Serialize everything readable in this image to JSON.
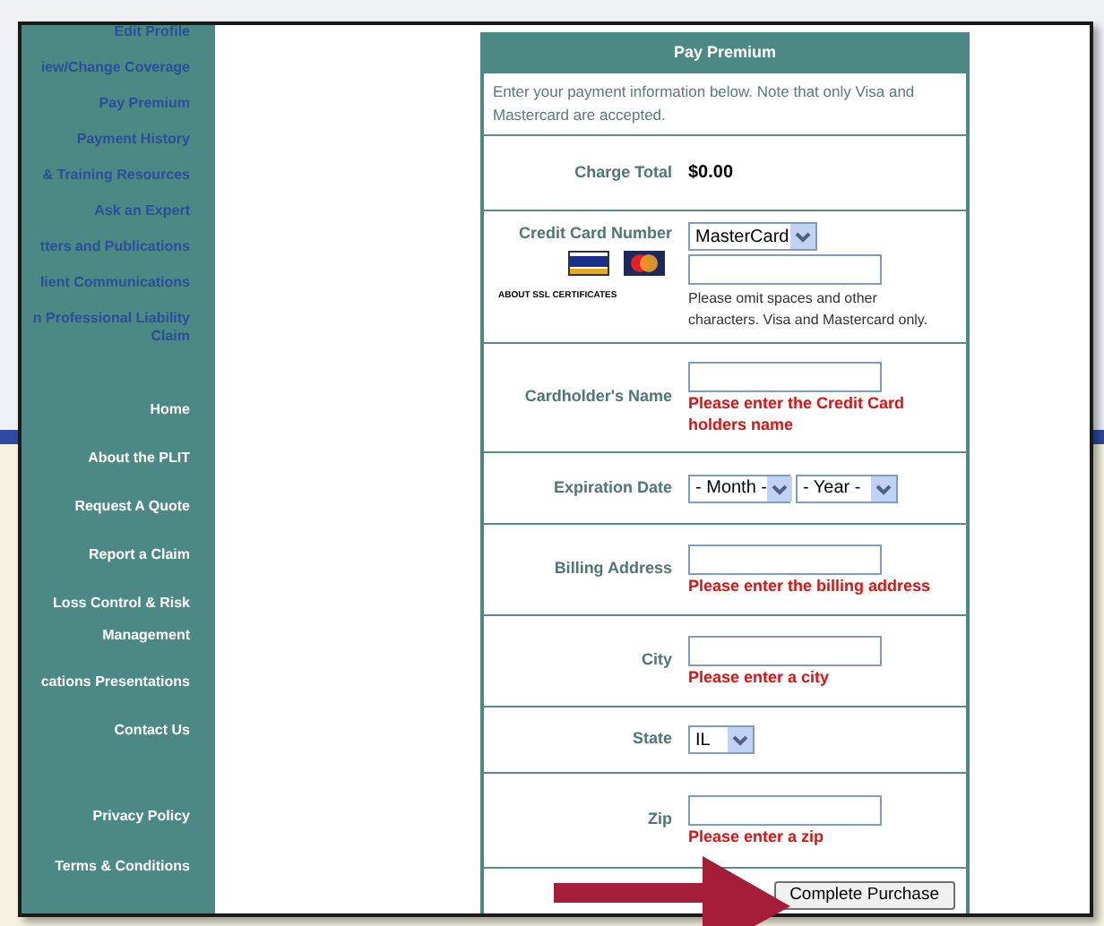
{
  "sidebar": {
    "links": [
      "Edit Profile",
      "iew/Change Coverage",
      "Pay Premium",
      "Payment History",
      "& Training Resources",
      "Ask an Expert",
      "tters and Publications",
      "lient Communications",
      "n Professional Liability Claim"
    ],
    "nav": [
      "Home",
      "About the PLIT",
      "Request A Quote",
      "Report a Claim",
      "Loss Control & Risk Management",
      "cations Presentations",
      "Contact Us"
    ],
    "footer_links": [
      "Privacy Policy",
      "Terms & Conditions"
    ]
  },
  "form": {
    "title": "Pay Premium",
    "intro": "Enter your payment information below. Note that only Visa and Mastercard are accepted.",
    "rows": [
      {
        "kind": "value",
        "label": "Charge Total",
        "value": "$0.00"
      },
      {
        "kind": "card",
        "label": "Credit Card Number",
        "select": "MasterCard",
        "ssl": "ABOUT SSL CERTIFICATES",
        "note": "Please omit spaces and other characters. Visa and Mastercard only."
      },
      {
        "kind": "input",
        "label": "Cardholder's Name",
        "error": "Please enter the Credit Card holders name"
      },
      {
        "kind": "selects",
        "label": "Expiration Date",
        "selects": [
          "- Month -",
          "- Year -"
        ]
      },
      {
        "kind": "input",
        "label": "Billing Address",
        "error": "Please enter the billing address"
      },
      {
        "kind": "input",
        "label": "City",
        "error": "Please enter a city"
      },
      {
        "kind": "selects",
        "label": "State",
        "selects": [
          "IL"
        ]
      },
      {
        "kind": "input",
        "label": "Zip",
        "error": "Please enter a zip"
      }
    ],
    "submit": "Complete Purchase"
  }
}
